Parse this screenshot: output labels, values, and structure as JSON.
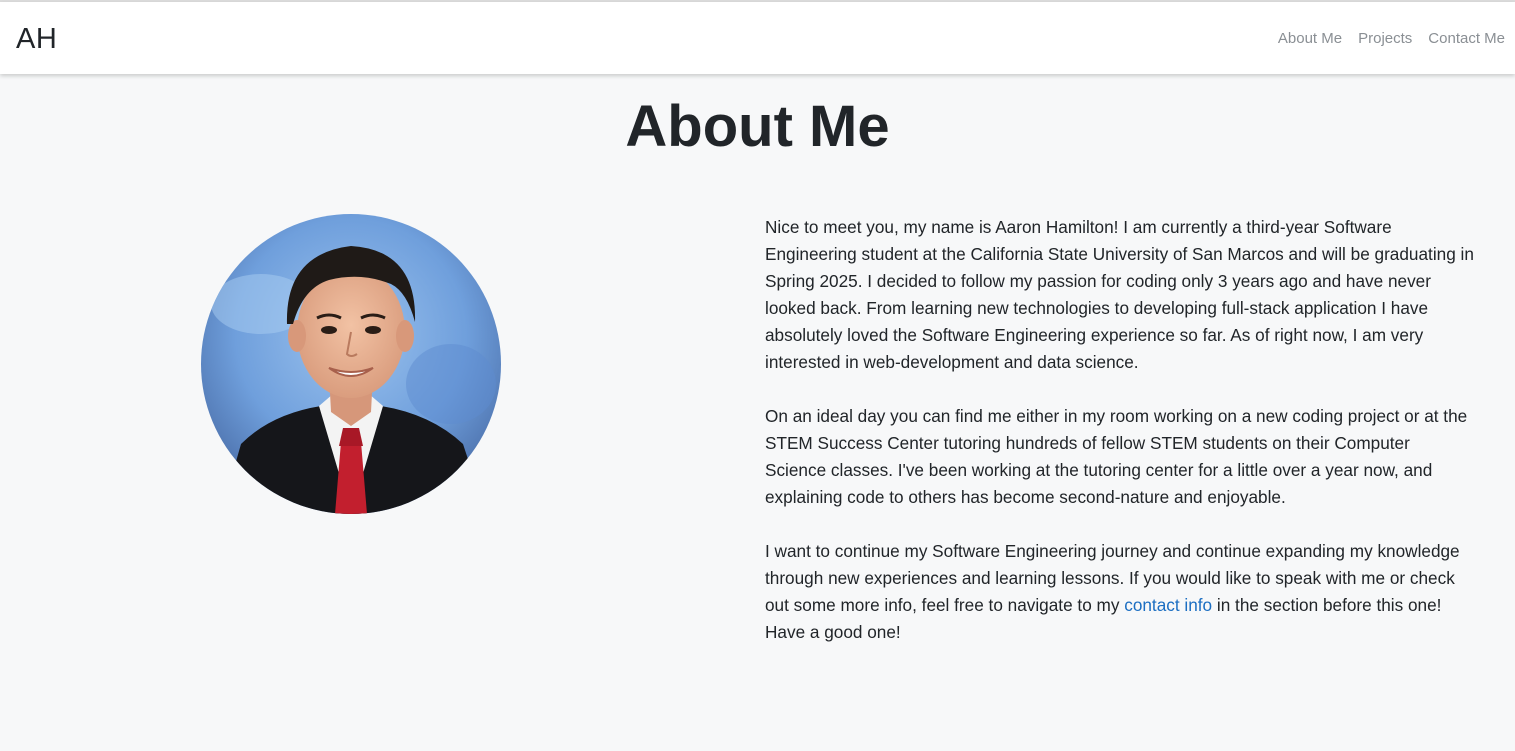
{
  "navbar": {
    "brand": "AH",
    "links": [
      {
        "label": "About Me"
      },
      {
        "label": "Projects"
      },
      {
        "label": "Contact Me"
      }
    ]
  },
  "main": {
    "title": "About Me",
    "paragraphs": [
      "Nice to meet you, my name is Aaron Hamilton! I am currently a third-year Software Engineering student at the California State University of San Marcos and will be graduating in Spring 2025. I decided to follow my passion for coding only 3 years ago and have never looked back. From learning new technologies to developing full-stack application I have absolutely loved the Software Engineering experience so far. As of right now, I am very interested in web-development and data science.",
      "On an ideal day you can find me either in my room working on a new coding project or at the STEM Success Center tutoring hundreds of fellow STEM students on their Computer Science classes. I've been working at the tutoring center for a little over a year now, and explaining code to others has become second-nature and enjoyable."
    ],
    "last_paragraph": {
      "before_link": "I want to continue my Software Engineering journey and continue expanding my knowledge through new experiences and learning lessons. If you would like to speak with me or check out some more info, feel free to navigate to my ",
      "link_text": "contact info",
      "after_link": " in the section before this one! Have a good one!"
    }
  },
  "colors": {
    "background": "#f7f8f9",
    "nav_link": "#8a8f94",
    "text": "#212529",
    "link": "#1b6ec2"
  }
}
